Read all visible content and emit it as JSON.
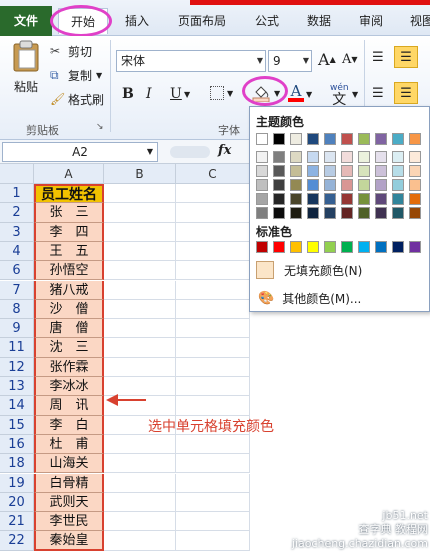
{
  "ribbon_tabs": [
    {
      "label": "文件"
    },
    {
      "label": "开始"
    },
    {
      "label": "插入"
    },
    {
      "label": "页面布局"
    },
    {
      "label": "公式"
    },
    {
      "label": "数据"
    },
    {
      "label": "审阅"
    },
    {
      "label": "视图"
    }
  ],
  "clipboard": {
    "paste": "粘贴",
    "cut": "剪切",
    "copy": "复制",
    "format_painter": "格式刷",
    "group_label": "剪贴板"
  },
  "font": {
    "name": "宋体",
    "size": "9",
    "group_label": "字体",
    "bold": "B",
    "italic": "I",
    "underline": "U",
    "grow": "A",
    "shrink": "A",
    "wen": "wén"
  },
  "formula_bar": {
    "name_box": "A2",
    "fx": "fx"
  },
  "columns": [
    "A",
    "B",
    "C"
  ],
  "rows": [
    {
      "num": "1",
      "value": "员工姓名"
    },
    {
      "num": "2",
      "value": "张　三"
    },
    {
      "num": "3",
      "value": "李　四"
    },
    {
      "num": "4",
      "value": "王　五"
    },
    {
      "num": "6",
      "value": "孙悟空"
    },
    {
      "num": "7",
      "value": "猪八戒"
    },
    {
      "num": "8",
      "value": "沙　僧"
    },
    {
      "num": "9",
      "value": "唐　僧"
    },
    {
      "num": "11",
      "value": "沈　三"
    },
    {
      "num": "12",
      "value": "张作霖"
    },
    {
      "num": "13",
      "value": "李冰冰"
    },
    {
      "num": "14",
      "value": "周　讯"
    },
    {
      "num": "15",
      "value": "李　白"
    },
    {
      "num": "16",
      "value": "杜　甫"
    },
    {
      "num": "18",
      "value": "山海关"
    },
    {
      "num": "19",
      "value": "白骨精"
    },
    {
      "num": "20",
      "value": "武则天"
    },
    {
      "num": "21",
      "value": "李世民"
    },
    {
      "num": "22",
      "value": "秦始皇"
    }
  ],
  "fill_menu": {
    "theme_title": "主题颜色",
    "standard_title": "标准色",
    "no_fill": "无填充颜色(N)",
    "more_colors": "其他颜色(M)..."
  },
  "theme_colors_top": [
    "#ffffff",
    "#000000",
    "#eeece1",
    "#1f497d",
    "#4f81bd",
    "#c0504d",
    "#9bbb59",
    "#8064a2",
    "#4bacc6",
    "#f79646"
  ],
  "theme_shade_columns": [
    [
      "#f2f2f2",
      "#d8d8d8",
      "#bfbfbf",
      "#a5a5a5",
      "#7f7f7f"
    ],
    [
      "#7f7f7f",
      "#595959",
      "#3f3f3f",
      "#262626",
      "#0c0c0c"
    ],
    [
      "#ddd9c3",
      "#c4bd97",
      "#938953",
      "#494429",
      "#1d1b10"
    ],
    [
      "#c6d9f0",
      "#8db3e2",
      "#548dd4",
      "#17365d",
      "#0f243e"
    ],
    [
      "#dbe5f1",
      "#b8cce4",
      "#95b3d7",
      "#366092",
      "#244061"
    ],
    [
      "#f2dcdb",
      "#e5b9b7",
      "#d99694",
      "#953734",
      "#632423"
    ],
    [
      "#ebf1dd",
      "#d7e3bc",
      "#c3d69b",
      "#76923c",
      "#4f6128"
    ],
    [
      "#e5e0ec",
      "#ccc1d9",
      "#b2a2c7",
      "#5f497a",
      "#3f3151"
    ],
    [
      "#dbeef3",
      "#b7dde8",
      "#92cddc",
      "#31859b",
      "#205867"
    ],
    [
      "#fdeada",
      "#fbd5b5",
      "#fac08f",
      "#e36c09",
      "#974806"
    ]
  ],
  "standard_colors": [
    "#c00000",
    "#ff0000",
    "#ffc000",
    "#ffff00",
    "#92d050",
    "#00b050",
    "#00b0f0",
    "#0070c0",
    "#002060",
    "#7030a0"
  ],
  "annotation": "选中单元格填充颜色",
  "watermark": {
    "line1": "jb51.net",
    "line2": "查字典 教程网",
    "line3": "jiaocheng.chazidian.com"
  }
}
